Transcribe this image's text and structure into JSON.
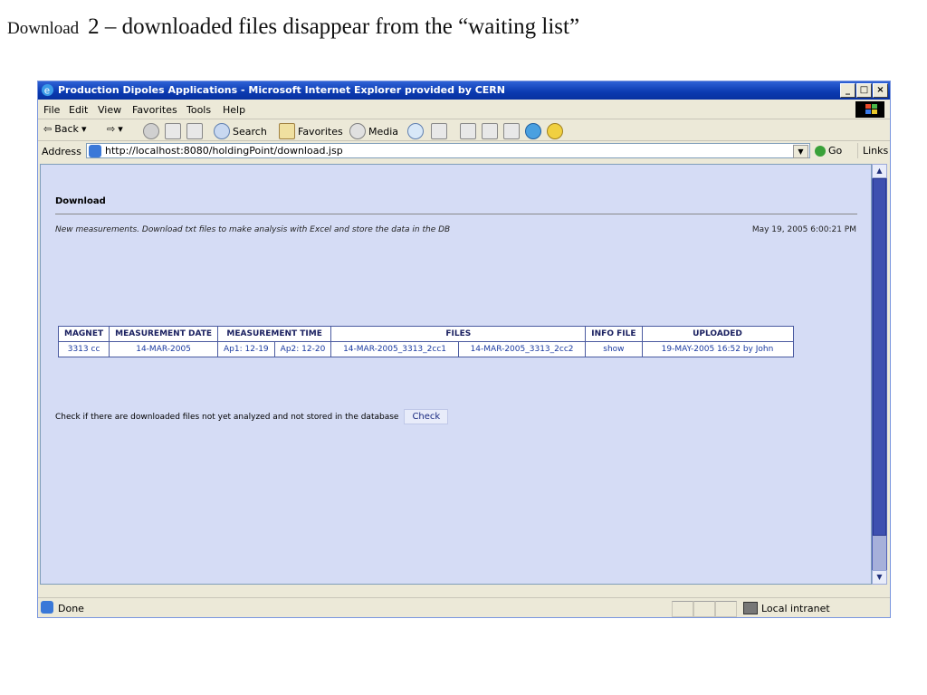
{
  "slide": {
    "title_word": "Download",
    "title_rest": "2 – downloaded files disappear from the “waiting list”"
  },
  "window": {
    "title": "Production Dipoles Applications - Microsoft Internet Explorer provided by CERN",
    "buttons": [
      "_",
      "□",
      "×"
    ]
  },
  "menu": [
    "File",
    "Edit",
    "View",
    "Favorites",
    "Tools",
    "Help"
  ],
  "toolbar": {
    "back": "Back",
    "search": "Search",
    "favorites": "Favorites",
    "media": "Media"
  },
  "address": {
    "label": "Address",
    "url": "http://localhost:8080/holdingPoint/download.jsp",
    "go": "Go",
    "links": "Links"
  },
  "page": {
    "heading": "Download",
    "description": "New measurements.  Download txt files to make analysis with Excel and store the data in the DB",
    "datetime": "May 19, 2005 6:00:21 PM",
    "table": {
      "headers": [
        "MAGNET",
        "MEASUREMENT DATE",
        "MEASUREMENT TIME",
        "FILES",
        "INFO FILE",
        "UPLOADED"
      ],
      "row": {
        "magnet": "3313 cc",
        "date": "14-MAR-2005",
        "time1": "Ap1: 12-19",
        "time2": "Ap2: 12-20",
        "file1": "14-MAR-2005_3313_2cc1",
        "file2": "14-MAR-2005_3313_2cc2",
        "info": "show",
        "uploaded": "19-MAY-2005 16:52 by John"
      }
    },
    "check_text": "Check if there are downloaded files not yet analyzed and not stored in the database",
    "check_button": "Check"
  },
  "status": {
    "text": "Done",
    "zone": "Local intranet"
  },
  "colors": {
    "titlebar": "#0a3ab0",
    "content_bg": "#d5dcf5",
    "scrollbar": "#4e5fb8",
    "link": "#1a3aa0"
  }
}
